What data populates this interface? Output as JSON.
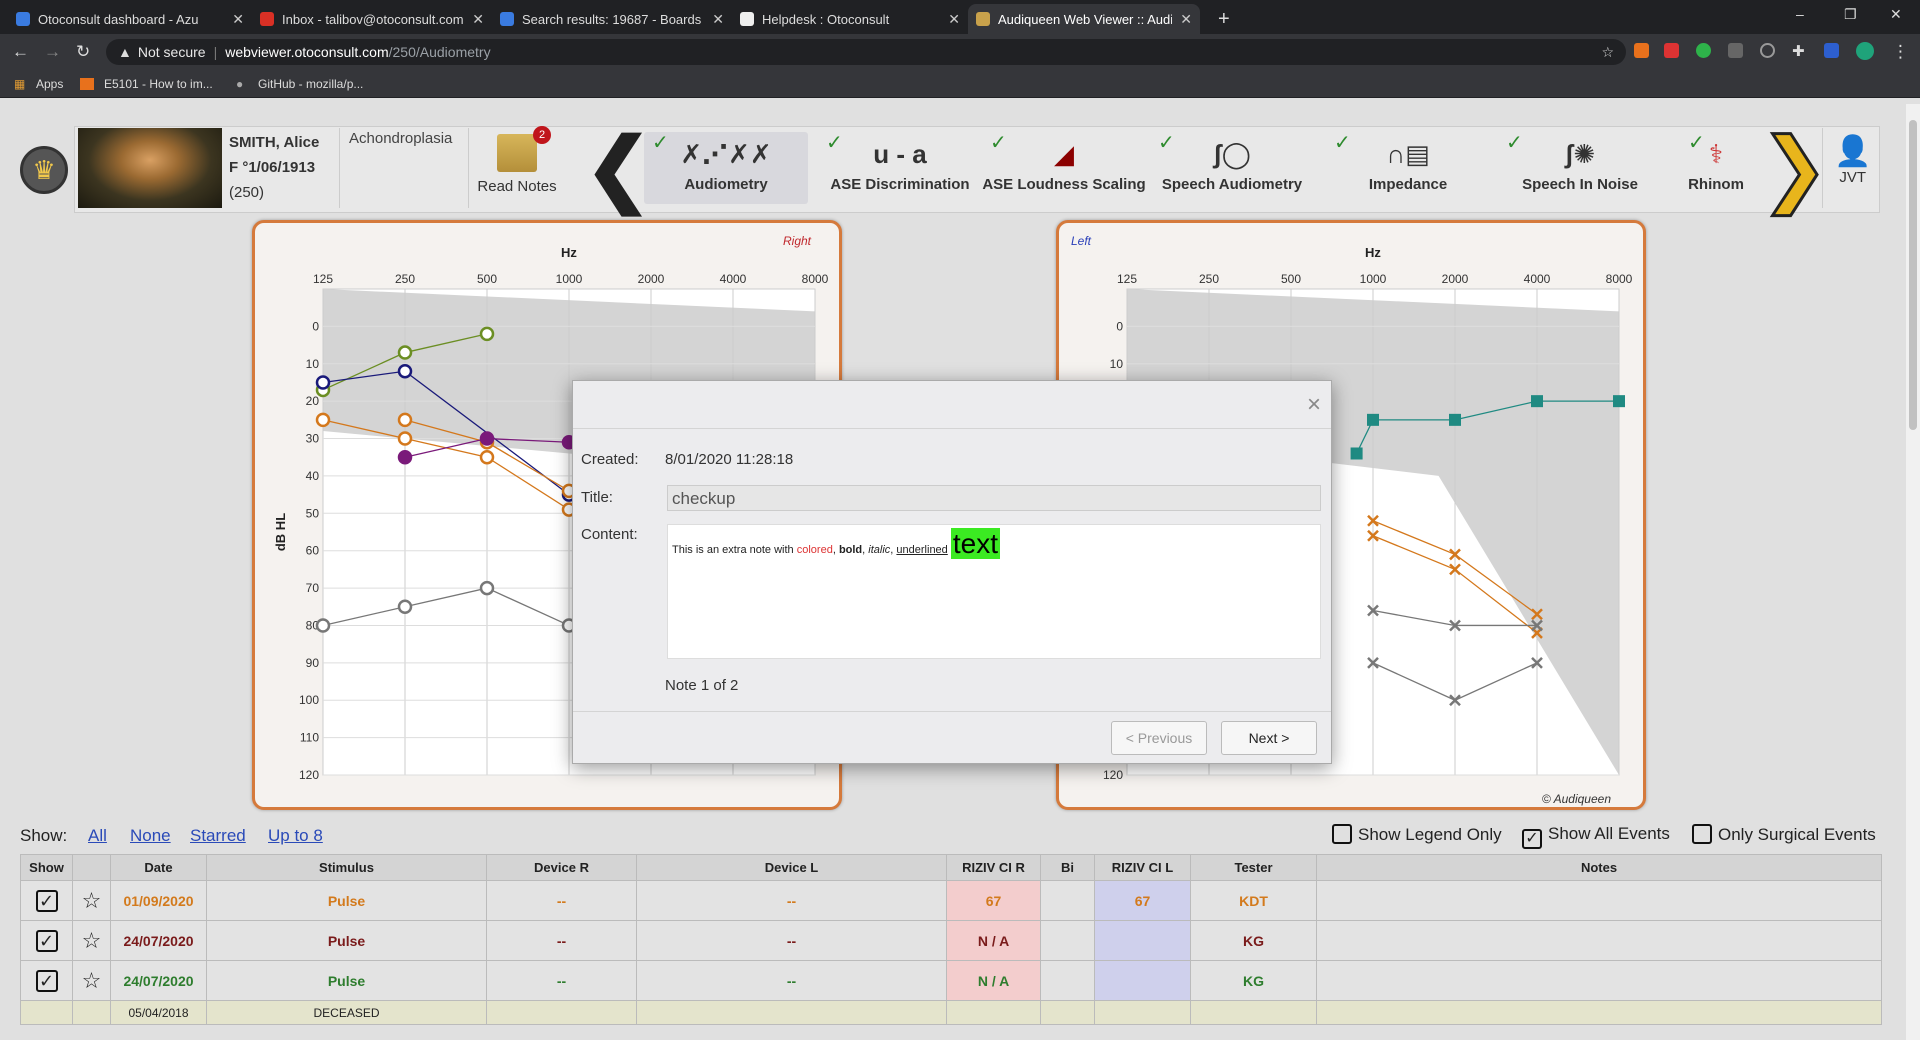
{
  "tabs": [
    {
      "title": "Otoconsult dashboard - Azu",
      "color": "#3a7be0"
    },
    {
      "title": "Inbox - talibov@otoconsult.com",
      "color": "#d93025"
    },
    {
      "title": "Search results: 19687 - Boards",
      "color": "#3a7be0"
    },
    {
      "title": "Helpdesk : Otoconsult",
      "color": "#eeeeee"
    },
    {
      "title": "Audiqueen Web Viewer :: Audion",
      "color": "#c8a14b"
    }
  ],
  "window_controls": {
    "minimize": "–",
    "restore": "❐",
    "close": "✕"
  },
  "address": {
    "security": "Not secure",
    "host": "webviewer.otoconsult.com",
    "path": "/250/Audiometry"
  },
  "bookmarks": [
    "Apps",
    "E5101 - How to im...",
    "GitHub - mozilla/p..."
  ],
  "patient": {
    "name": "SMITH, Alice",
    "dob": "F °1/06/1913",
    "id": "(250)",
    "diagnosis": "Achondroplasia"
  },
  "read_notes": {
    "label": "Read Notes",
    "count": "2"
  },
  "tools": [
    {
      "label": "Audiometry",
      "icon": "✗⋰✗✗"
    },
    {
      "label": "ASE Discrimination",
      "icon": "u - a"
    },
    {
      "label": "ASE Loudness Scaling",
      "icon": "◢"
    },
    {
      "label": "Speech Audiometry",
      "icon": "ʃ◯"
    },
    {
      "label": "Impedance",
      "icon": "∩▤"
    },
    {
      "label": "Speech In Noise",
      "icon": "ʃ✺"
    },
    {
      "label": "Rhinom",
      "icon": "⚕"
    }
  ],
  "user": "JVT",
  "chart_data": [
    {
      "type": "scatter",
      "title": "Right",
      "xlabel": "Hz",
      "ylabel": "dB HL",
      "x_ticks": [
        "125",
        "250",
        "500",
        "1000",
        "2000",
        "4000",
        "8000"
      ],
      "y_ticks": [
        "0",
        "10",
        "20",
        "30",
        "40",
        "50",
        "60",
        "70",
        "80",
        "90",
        "100",
        "110",
        "120"
      ],
      "ylim": [
        -10,
        120
      ],
      "series": [
        {
          "color": "#6b8e23",
          "points": [
            [
              0,
              17
            ],
            [
              1,
              7
            ],
            [
              2,
              2
            ]
          ]
        },
        {
          "color": "#1a1a7a",
          "points": [
            [
              0,
              15
            ],
            [
              1,
              12
            ],
            [
              3,
              45
            ]
          ]
        },
        {
          "color": "#d4781c",
          "points": [
            [
              0,
              25
            ],
            [
              1,
              30
            ],
            [
              2,
              35
            ],
            [
              3,
              49
            ]
          ]
        },
        {
          "color": "#d4781c",
          "points": [
            [
              1,
              25
            ],
            [
              2,
              31
            ],
            [
              3,
              44
            ]
          ]
        },
        {
          "color": "#7a1a7a",
          "points": [
            [
              1,
              35
            ],
            [
              2,
              30
            ],
            [
              3,
              31
            ]
          ]
        },
        {
          "color": "#777777",
          "points": [
            [
              0,
              80
            ],
            [
              1,
              75
            ],
            [
              2,
              70
            ],
            [
              3,
              80
            ]
          ]
        }
      ]
    },
    {
      "type": "scatter",
      "title": "Left",
      "xlabel": "Hz",
      "credit": "© Audiqueen",
      "x_ticks": [
        "125",
        "250",
        "500",
        "1000",
        "2000",
        "4000",
        "8000"
      ],
      "y_ticks": [
        "0",
        "10",
        "120"
      ],
      "ylim": [
        -10,
        120
      ],
      "series": [
        {
          "color": "#1f8a82",
          "points": [
            [
              2.8,
              34
            ],
            [
              3,
              25
            ],
            [
              4,
              25
            ],
            [
              5,
              20
            ],
            [
              6,
              20
            ]
          ]
        },
        {
          "color": "#d4781c",
          "points": [
            [
              3,
              56
            ],
            [
              4,
              65
            ],
            [
              5,
              82
            ]
          ]
        },
        {
          "color": "#d4781c",
          "points": [
            [
              3,
              52
            ],
            [
              4,
              61
            ],
            [
              5,
              77
            ]
          ]
        },
        {
          "color": "#777777",
          "points": [
            [
              3,
              90
            ],
            [
              4,
              100
            ],
            [
              5,
              90
            ]
          ]
        },
        {
          "color": "#777777",
          "points": [
            [
              3,
              76
            ],
            [
              4,
              80
            ],
            [
              5,
              80
            ]
          ]
        }
      ]
    }
  ],
  "modal": {
    "created_label": "Created:",
    "created": "8/01/2020 11:28:18",
    "title_label": "Title:",
    "title": "checkup",
    "content_label": "Content:",
    "content_parts": [
      "This is an extra note with ",
      "colored",
      ", ",
      "bold",
      ", ",
      "italic",
      ", ",
      "underlined",
      " ",
      "text"
    ],
    "counter": "Note 1 of 2",
    "prev": "< Previous",
    "next": "Next >",
    "close": "×"
  },
  "show": {
    "label": "Show:",
    "links": [
      "All",
      "None",
      "Starred",
      "Up to 8"
    ],
    "opts": [
      {
        "label": "Show Legend Only",
        "checked": false
      },
      {
        "label": "Show All Events",
        "checked": true
      },
      {
        "label": "Only Surgical Events",
        "checked": false
      }
    ]
  },
  "table": {
    "headers": [
      "Show",
      "",
      "Date",
      "Stimulus",
      "Device R",
      "Device L",
      "RIZIV CI R",
      "Bi",
      "RIZIV CI L",
      "Tester",
      "Notes"
    ],
    "rows": [
      {
        "date": "01/09/2020",
        "stim": "Pulse",
        "devr": "--",
        "devl": "--",
        "rizr": "67",
        "bi": "",
        "rizl": "67",
        "tester": "KDT",
        "cls": "orange"
      },
      {
        "date": "24/07/2020",
        "stim": "Pulse",
        "devr": "--",
        "devl": "--",
        "rizr": "N / A",
        "bi": "",
        "rizl": "",
        "tester": "KG",
        "cls": "maroon"
      },
      {
        "date": "24/07/2020",
        "stim": "Pulse",
        "devr": "--",
        "devl": "--",
        "rizr": "N / A",
        "bi": "",
        "rizl": "",
        "tester": "KG",
        "cls": "green"
      }
    ],
    "deceased": {
      "date": "05/04/2018",
      "label": "DECEASED"
    }
  }
}
